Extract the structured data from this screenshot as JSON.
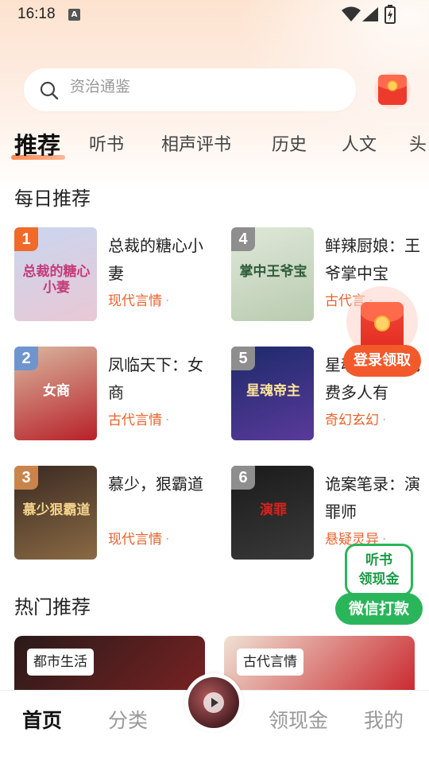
{
  "status_bar": {
    "time": "16:18",
    "notif_glyph": "A",
    "icons": [
      "wifi-icon",
      "signal-icon",
      "battery-charging-icon"
    ]
  },
  "search": {
    "placeholder": "资治通鉴",
    "icon": "search-icon"
  },
  "top_right": {
    "icon": "red-envelope-icon"
  },
  "tabs": [
    {
      "label": "推荐",
      "active": true
    },
    {
      "label": "听书"
    },
    {
      "label": "相声评书"
    },
    {
      "label": "历史"
    },
    {
      "label": "人文"
    },
    {
      "label": "头"
    }
  ],
  "daily": {
    "title": "每日推荐",
    "books": [
      {
        "rank": "1",
        "title": "总裁的糖心小妻",
        "genre": "现代言情",
        "rank_color": "#f06a2a",
        "cover_text": "总裁的糖心小妻",
        "cover_colors": [
          "#c9d6f0",
          "#e9c8d4"
        ],
        "cover_text_color": "#c43c7a"
      },
      {
        "rank": "2",
        "title": "凤临天下：女商",
        "genre": "古代言情",
        "rank_color": "#6f95cf",
        "cover_text": "女商",
        "cover_colors": [
          "#d9b8a0",
          "#b82028"
        ],
        "cover_text_color": "#ffffff"
      },
      {
        "rank": "3",
        "title": "慕少，狠霸道",
        "genre": "现代言情",
        "rank_color": "#c9844b",
        "cover_text": "慕少狠霸道",
        "cover_colors": [
          "#3a2a22",
          "#8a6a44"
        ],
        "cover_text_color": "#f2d38a"
      },
      {
        "rank": "4",
        "title": "鲜辣厨娘：王爷掌中宝",
        "genre": "古代言",
        "rank_color": "#8e8e8e",
        "cover_text": "掌中王爷宝",
        "cover_colors": [
          "#dfe8d8",
          "#b9cbb0"
        ],
        "cover_text_color": "#2f5d3a"
      },
      {
        "rank": "5",
        "title": "星魂帝主：免费多人有",
        "genre": "奇幻玄幻",
        "rank_color": "#8e8e8e",
        "cover_text": "星魂帝主",
        "cover_colors": [
          "#1c2a6a",
          "#5a3a9a"
        ],
        "cover_text_color": "#ffe59a"
      },
      {
        "rank": "6",
        "title": "诡案笔录：演罪师",
        "genre": "悬疑灵异",
        "rank_color": "#8e8e8e",
        "cover_text": "演罪",
        "cover_colors": [
          "#1a1a1a",
          "#3a3a3a"
        ],
        "cover_text_color": "#d8231c"
      }
    ]
  },
  "floating_redpacket": {
    "label": "登录领取",
    "icon": "red-envelope-icon"
  },
  "wechat_widget": {
    "top_line1": "听书",
    "top_line2": "领现金",
    "button": "微信打款"
  },
  "hot": {
    "title": "热门推荐",
    "cards": [
      {
        "tag": "都市生活",
        "colors": [
          "#2a1a1a",
          "#7a2222"
        ]
      },
      {
        "tag": "古代言情",
        "colors": [
          "#efe2d4",
          "#c9242a"
        ]
      }
    ]
  },
  "bottom_nav": {
    "items": [
      {
        "label": "首页",
        "active": true
      },
      {
        "label": "分类"
      },
      {
        "label": "领现金"
      },
      {
        "label": "我的"
      }
    ],
    "center_icon": "play-icon"
  }
}
